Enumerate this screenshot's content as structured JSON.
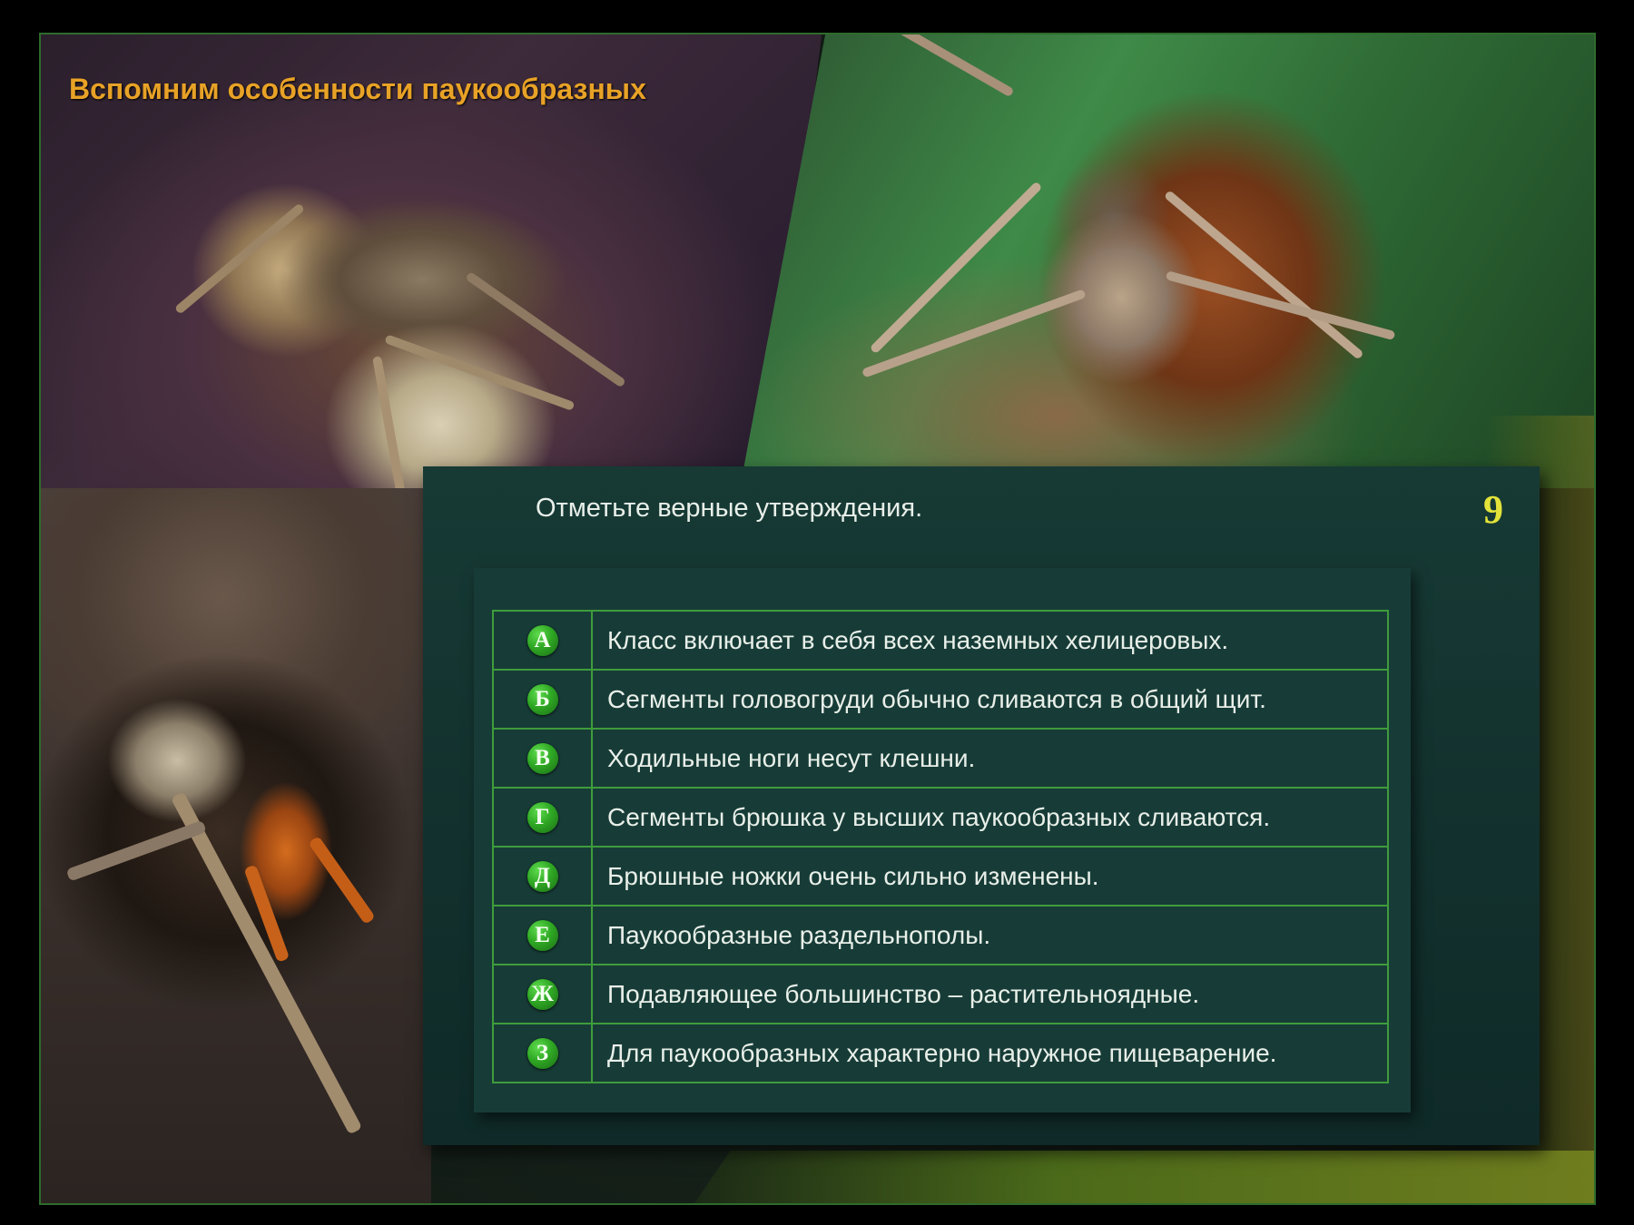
{
  "title": "Вспомним особенности паукообразных",
  "question": "Отметьте верные утверждения.",
  "question_number": "9",
  "options": [
    {
      "letter": "А",
      "text": "Класс включает в себя всех наземных хелицеровых."
    },
    {
      "letter": "Б",
      "text": "Сегменты головогруди обычно сливаются в общий щит."
    },
    {
      "letter": "В",
      "text": "Ходильные ноги несут клешни."
    },
    {
      "letter": "Г",
      "text": "Сегменты брюшка у высших паукообразных сливаются."
    },
    {
      "letter": "Д",
      "text": "Брюшные ножки очень сильно изменены."
    },
    {
      "letter": "Е",
      "text": "Паукообразные раздельнополы."
    },
    {
      "letter": "Ж",
      "text": "Подавляющее большинство – растительноядные."
    },
    {
      "letter": "З",
      "text": "Для паукообразных характерно наружное пищеварение."
    }
  ],
  "colors": {
    "title": "#e8a226",
    "badge": "#2fa824",
    "table_border": "#3f9c3c",
    "question_number": "#e3e33a",
    "panel": "#12302d"
  }
}
